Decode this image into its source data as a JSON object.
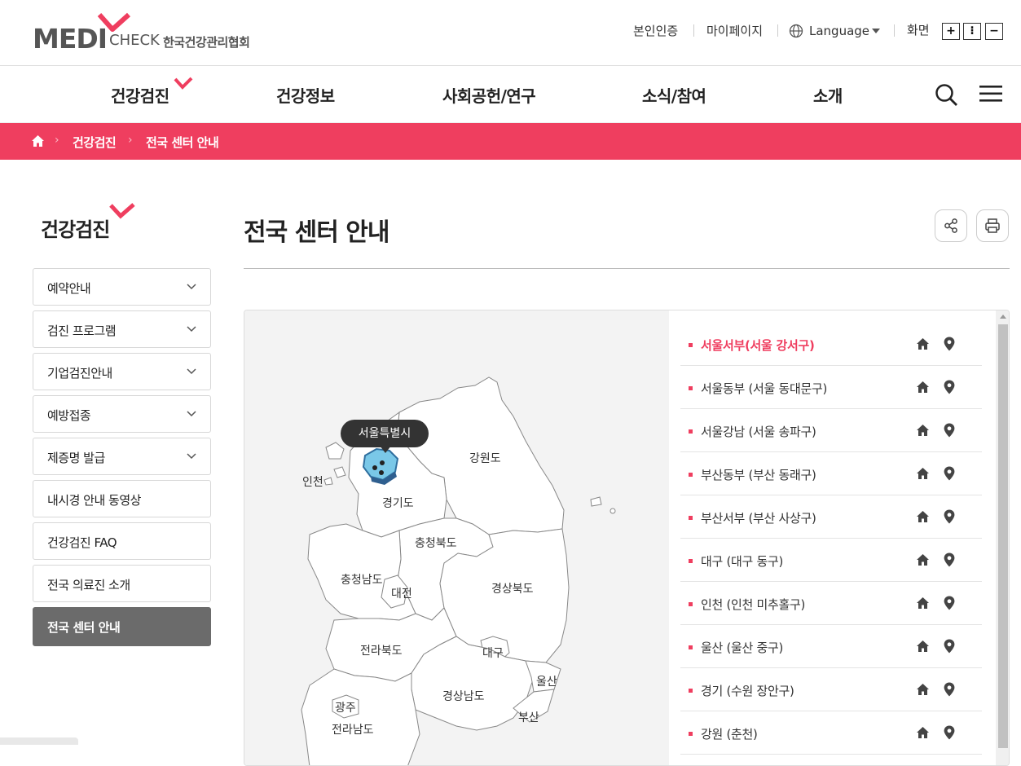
{
  "brand": {
    "logo_main": "MEDI",
    "logo_sub": "CHECK",
    "association": "한국건강관리협회",
    "accent_color": "#ef3e5f"
  },
  "utility": {
    "verify": "본인인증",
    "mypage": "마이페이지",
    "language": "Language",
    "screen": "화면",
    "zoom_in": "+",
    "zoom_reset": "⁝",
    "zoom_out": "−"
  },
  "gnb": {
    "items": [
      "건강검진",
      "건강정보",
      "사회공헌/연구",
      "소식/참여",
      "소개"
    ]
  },
  "breadcrumb": {
    "items": [
      "건강검진",
      "전국 센터 안내"
    ]
  },
  "sidebar": {
    "title": "건강검진",
    "items": [
      {
        "label": "예약안내",
        "expandable": true
      },
      {
        "label": "검진 프로그램",
        "expandable": true
      },
      {
        "label": "기업검진안내",
        "expandable": true
      },
      {
        "label": "예방접종",
        "expandable": true
      },
      {
        "label": "제증명 발급",
        "expandable": true
      },
      {
        "label": "내시경 안내 동영상",
        "expandable": false
      },
      {
        "label": "건강검진 FAQ",
        "expandable": false
      },
      {
        "label": "전국 의료진 소개",
        "expandable": false
      },
      {
        "label": "전국 센터 안내",
        "expandable": false,
        "active": true
      }
    ]
  },
  "content": {
    "title": "전국 센터 안내"
  },
  "map": {
    "tooltip": "서울특별시",
    "regions": [
      "인천",
      "강원도",
      "경기도",
      "충청북도",
      "충청남도",
      "대전",
      "경상북도",
      "전라북도",
      "대구",
      "울산",
      "경상남도",
      "광주",
      "부산",
      "전라남도"
    ]
  },
  "centers": [
    {
      "name": "서울서부(서울 강서구)",
      "active": true
    },
    {
      "name": "서울동부 (서울 동대문구)"
    },
    {
      "name": "서울강남 (서울 송파구)"
    },
    {
      "name": "부산동부 (부산 동래구)"
    },
    {
      "name": "부산서부 (부산 사상구)"
    },
    {
      "name": "대구 (대구 동구)"
    },
    {
      "name": "인천 (인천 미추홀구)"
    },
    {
      "name": "울산 (울산 중구)"
    },
    {
      "name": "경기 (수원 장안구)"
    },
    {
      "name": "강원 (춘천)"
    }
  ],
  "icons": {
    "home": "home-icon",
    "location": "map-pin-icon",
    "share": "share-icon",
    "print": "print-icon",
    "search": "search-icon",
    "menu": "hamburger-icon",
    "globe": "globe-icon"
  }
}
